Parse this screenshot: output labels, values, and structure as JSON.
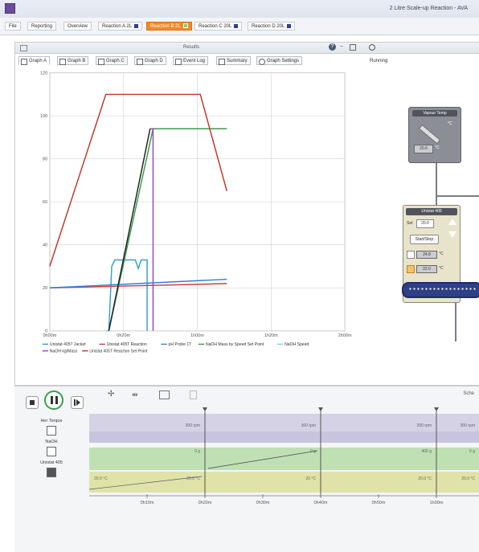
{
  "window": {
    "title": "2 Litre Scale-up Reaction - AVA",
    "tabs": [
      {
        "label": "File",
        "active": false,
        "marker": false
      },
      {
        "label": "Reporting",
        "active": false,
        "marker": false
      },
      {
        "label": "Overview",
        "active": false,
        "marker": false
      },
      {
        "label": "Reaction A 2L",
        "active": false,
        "marker": true
      },
      {
        "label": "Reaction B 2L",
        "active": true,
        "marker": true
      },
      {
        "label": "Reaction C 20L",
        "active": false,
        "marker": true
      },
      {
        "label": "Reaction D 20L",
        "active": false,
        "marker": true
      }
    ]
  },
  "results": {
    "title": "Results",
    "help_icon": "question-icon",
    "minimize": "–",
    "graph_tabs": [
      {
        "label": "Graph A",
        "active": true
      },
      {
        "label": "Graph B",
        "active": false
      },
      {
        "label": "Graph C",
        "active": false
      },
      {
        "label": "Graph D",
        "active": false
      },
      {
        "label": "Event Log",
        "active": false
      },
      {
        "label": "Summary",
        "active": false
      },
      {
        "label": "Graph Settings",
        "active": false
      }
    ]
  },
  "chart_data": {
    "type": "line",
    "title": "",
    "xlabel": "",
    "ylabel": "",
    "ylim": [
      0,
      120
    ],
    "xlim": [
      0,
      200
    ],
    "x_ticks": [
      "0h00m",
      "0h20m",
      "1h00m",
      "1h20m",
      "2h00m"
    ],
    "x_tick_values": [
      0,
      50,
      100,
      150,
      200
    ],
    "y_ticks": [
      0,
      20,
      40,
      60,
      80,
      100,
      120
    ],
    "grid": true,
    "legend_placement": "bottom",
    "series": [
      {
        "name": "Unistat 405T Jacket",
        "color": "#3aa0c8",
        "points": [
          [
            40,
            0
          ],
          [
            42,
            30
          ],
          [
            44,
            33
          ],
          [
            58,
            33
          ],
          [
            60,
            29
          ],
          [
            62,
            33
          ],
          [
            66,
            33
          ],
          [
            66,
            0
          ]
        ]
      },
      {
        "name": "Unistat 405T Reaction",
        "color": "#d23c3c",
        "points": [
          [
            0,
            20
          ],
          [
            120,
            22
          ]
        ]
      },
      {
        "name": "pH Probe 1T",
        "color": "#2f7fd8",
        "points": [
          [
            0,
            20
          ],
          [
            120,
            24
          ]
        ]
      },
      {
        "name": "NaOH Mass by Speed Set Point",
        "color": "#3b9b4a",
        "points": [
          [
            40,
            0
          ],
          [
            70,
            94
          ],
          [
            120,
            94
          ]
        ]
      },
      {
        "name": "NaOH Speed",
        "color": "#7fd3e6",
        "points": [
          [
            38,
            0
          ],
          [
            40,
            0
          ]
        ]
      },
      {
        "name": "NaOH kg/Mass",
        "color": "#9a46c8",
        "points": [
          [
            68,
            94
          ],
          [
            70,
            94
          ],
          [
            70,
            0
          ]
        ]
      },
      {
        "name": "Unistat 405T Reaction Set Point",
        "color": "#c0392b",
        "points": [
          [
            0,
            30
          ],
          [
            38,
            110
          ],
          [
            102,
            110
          ],
          [
            120,
            65
          ]
        ]
      },
      {
        "name": "",
        "color": "#222222",
        "points": [
          [
            40,
            0
          ],
          [
            68,
            94
          ]
        ]
      }
    ]
  },
  "running": {
    "label": "Running",
    "vapour": {
      "title": "Vapour Temp",
      "value": "20.6",
      "unit": "°C"
    },
    "unistat": {
      "title": "Unistat 405",
      "set_label": "Set",
      "set_value": "20.0",
      "start_button": "Start/Stop",
      "reading1": "24.8",
      "reading2": "22.0",
      "unit": "°C"
    }
  },
  "bottom": {
    "schedule_label": "Sche",
    "row_labels": [
      "Her Torque",
      "NaOH",
      "Unistat 405"
    ],
    "time_ticks": [
      "0h10m",
      "0h20m",
      "0h30m",
      "0h40m",
      "0h50m",
      "1h00m",
      "1h10m"
    ],
    "blocks": {
      "torque": [
        "300 rpm",
        "300 rpm",
        "300 rpm",
        "300 rpm"
      ],
      "naoh": [
        "0 g",
        "0 g",
        "400 g",
        "0 g"
      ],
      "unistat": [
        "20.0 °C",
        "20.0 °C",
        "20 °C",
        "20.0 °C",
        "20.0 °C"
      ]
    }
  }
}
